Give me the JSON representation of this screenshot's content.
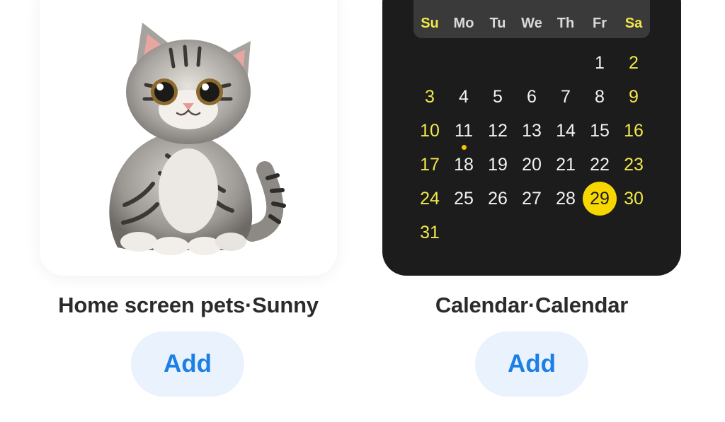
{
  "widgets": [
    {
      "title": "Home screen pets·Sunny",
      "add_label": "Add"
    },
    {
      "title": "Calendar·Calendar",
      "add_label": "Add"
    }
  ],
  "calendar": {
    "weekdays": [
      "Su",
      "Mo",
      "Tu",
      "We",
      "Th",
      "Fr",
      "Sa"
    ],
    "days": [
      "1",
      "2",
      "3",
      "4",
      "5",
      "6",
      "7",
      "8",
      "9",
      "10",
      "11",
      "12",
      "13",
      "14",
      "15",
      "16",
      "17",
      "18",
      "19",
      "20",
      "21",
      "22",
      "23",
      "24",
      "25",
      "26",
      "27",
      "28",
      "29",
      "30",
      "31"
    ],
    "first_weekday_index": 5,
    "today": "29",
    "event_days": [
      "11"
    ],
    "colors": {
      "background": "#1c1c1c",
      "weekend": "#f1e84a",
      "today_highlight": "#f6d800",
      "event_dot": "#f6c400"
    }
  },
  "colors": {
    "button_bg": "#e9f2fd",
    "button_text": "#1b7fe6"
  }
}
